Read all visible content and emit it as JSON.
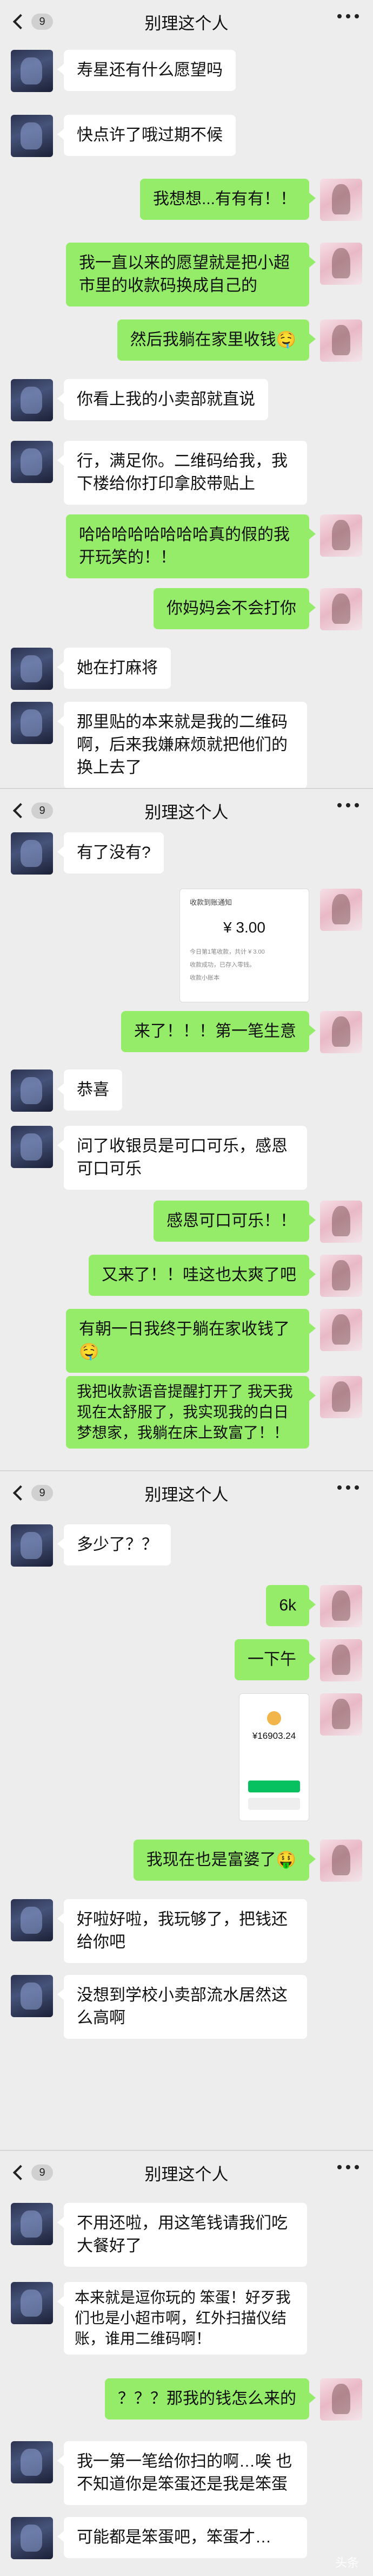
{
  "screens": [
    {
      "back_count": "9",
      "title": "别理这个人",
      "messages": [
        {
          "side": "left",
          "text": "寿星还有什么愿望吗"
        },
        {
          "side": "left",
          "text": "快点许了哦过期不候"
        },
        {
          "side": "right",
          "text": "我想想...有有有！！"
        },
        {
          "side": "right",
          "text": "我一直以来的愿望就是把小超市里的收款码换成自己的"
        },
        {
          "side": "right",
          "text": "然后我躺在家里收钱🤤"
        },
        {
          "side": "left",
          "text": "你看上我的小卖部就直说"
        },
        {
          "side": "left",
          "text": "行，满足你。二维码给我，我下楼给你打印拿胶带贴上"
        },
        {
          "side": "right",
          "text": "哈哈哈哈哈哈哈哈真的假的我开玩笑的！！"
        },
        {
          "side": "right",
          "text": "你妈妈会不会打你"
        },
        {
          "side": "left",
          "text": "她在打麻将"
        },
        {
          "side": "left",
          "text": "那里贴的本来就是我的二维码啊，后来我嫌麻烦就把他们的换上去了"
        }
      ]
    },
    {
      "back_count": "9",
      "title": "别理这个人",
      "messages": [
        {
          "side": "left",
          "text": "有了没有?"
        },
        {
          "side": "right",
          "type": "receipt",
          "receipt": {
            "header": "收款到账通知",
            "amount": "¥ 3.00",
            "line1": "今日第1笔收款，共计 ¥ 3.00",
            "line2": "收款成功，已存入零钱。",
            "footer": "收款小账本"
          }
        },
        {
          "side": "right",
          "text": "来了！！！第一笔生意"
        },
        {
          "side": "left",
          "text": "恭喜"
        },
        {
          "side": "left",
          "text": "问了收银员是可口可乐，感恩可口可乐"
        },
        {
          "side": "right",
          "text": "感恩可口可乐！！"
        },
        {
          "side": "right",
          "text": "又来了！！哇这也太爽了吧"
        },
        {
          "side": "right",
          "text": "有朝一日我终于躺在家收钱了🤤"
        },
        {
          "side": "right",
          "text": "我把收款语音提醒打开了 我天我现在太舒服了，我实现我的白日梦想家，我躺在床上致富了！！"
        }
      ]
    },
    {
      "back_count": "9",
      "title": "别理这个人",
      "messages": [
        {
          "side": "left",
          "text": "多少了？？"
        },
        {
          "side": "right",
          "text": "6k"
        },
        {
          "side": "right",
          "text": "一下午"
        },
        {
          "side": "right",
          "type": "wallet",
          "wallet": {
            "amount": "¥16903.24"
          }
        },
        {
          "side": "right",
          "text": "我现在也是富婆了🤑"
        },
        {
          "side": "left",
          "text": "好啦好啦，我玩够了，把钱还给你吧"
        },
        {
          "side": "left",
          "text": "没想到学校小卖部流水居然这么高啊"
        }
      ]
    },
    {
      "back_count": "9",
      "title": "别理这个人",
      "messages": [
        {
          "side": "left",
          "text": "不用还啦，用这笔钱请我们吃大餐好了"
        },
        {
          "side": "left",
          "text": "本来就是逗你玩的 笨蛋！好歹我们也是小超市啊，红外扫描仪结账，谁用二维码啊！"
        },
        {
          "side": "right",
          "text": "？？？那我的钱怎么来的"
        },
        {
          "side": "left",
          "text": "我一第一笔给你扫的啊…唉 也不知道你是笨蛋还是我是笨蛋"
        },
        {
          "side": "left",
          "text": "可能都是笨蛋吧，笨蛋才…"
        }
      ]
    }
  ],
  "watermark": "头条"
}
